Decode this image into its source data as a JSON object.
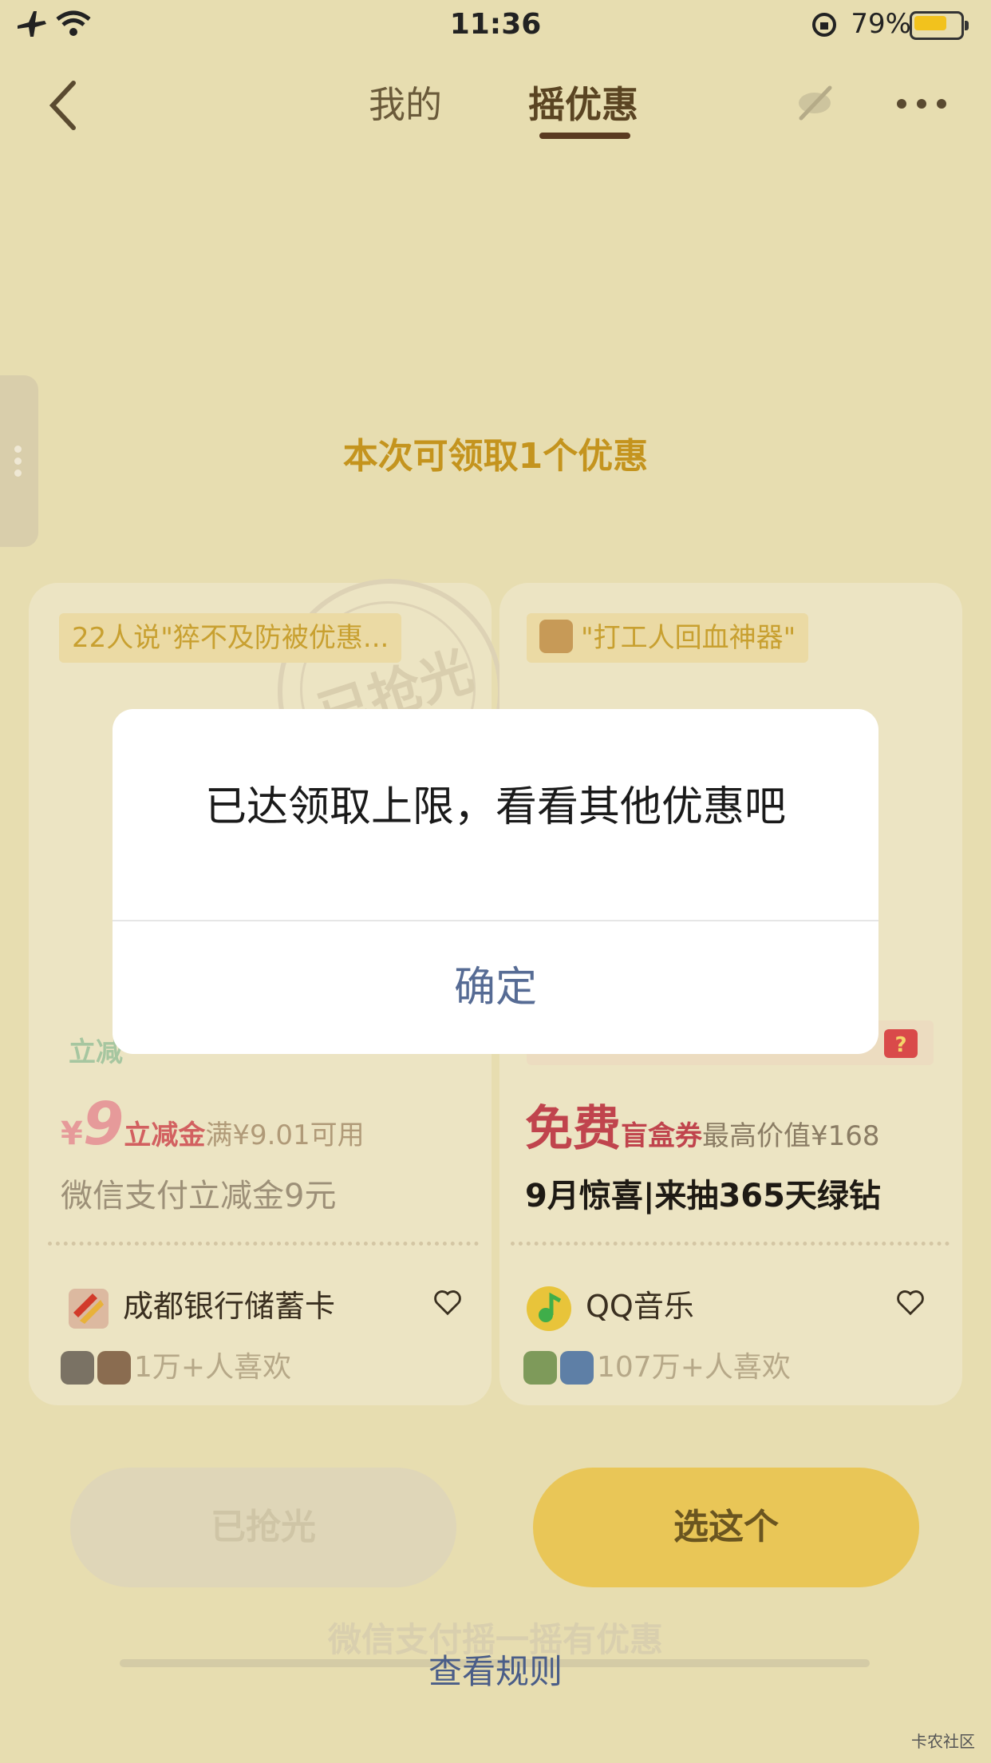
{
  "status_bar": {
    "time": "11:36",
    "battery_pct": "79%",
    "battery_level": 0.79
  },
  "nav": {
    "tabs": [
      "我的",
      "摇优惠"
    ],
    "active_tab": "摇优惠"
  },
  "headline": "本次可领取1个优惠",
  "cards": [
    {
      "tag": "22人说\"猝不及防被优惠...",
      "stamp": "已抢光",
      "label_partial": "立减",
      "price_symbol": "¥",
      "price_value": "9",
      "price_type": "立减金",
      "price_condition": "满¥9.01可用",
      "title": "微信支付立减金9元",
      "brand": "成都银行储蓄卡",
      "likes": "1万+人喜欢",
      "button": "已抢光"
    },
    {
      "tag": "\"打工人回血神器\"",
      "price_value": "免费",
      "price_type": "盲盒券",
      "price_condition": "最高价值¥168",
      "title": "9月惊喜|来抽365天绿钻",
      "brand": "QQ音乐",
      "likes": "107万+人喜欢",
      "button": "选这个"
    }
  ],
  "dialog": {
    "message": "已达领取上限，看看其他优惠吧",
    "confirm": "确定"
  },
  "footer": {
    "ghost": "微信支付摇一摇有优惠",
    "rules_link": "查看规则"
  },
  "watermark": "卡农社区",
  "colors": {
    "background": "#e7ddb0",
    "accent_gold": "#e9c657",
    "link_blue": "#566b94"
  },
  "icons": [
    "airplane-icon",
    "wifi-icon",
    "rotation-lock-icon",
    "battery-icon",
    "back-chevron-icon",
    "hide-eye-icon",
    "more-icon",
    "heart-icon",
    "gift-icon"
  ]
}
